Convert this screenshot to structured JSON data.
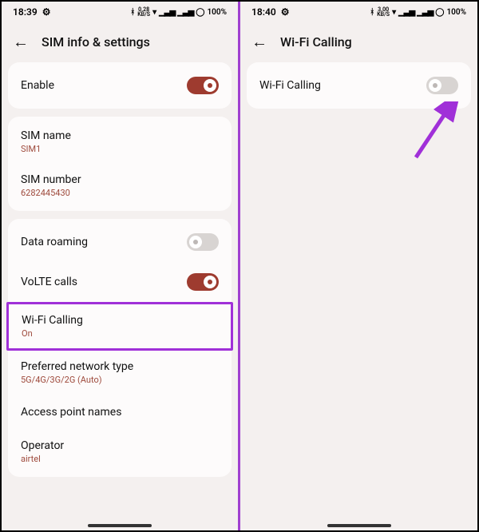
{
  "left": {
    "status": {
      "time": "18:39",
      "speed": "0.28",
      "speedUnit": "KB/S",
      "battery": "100%"
    },
    "header": {
      "title": "SIM info & settings"
    },
    "enable": {
      "label": "Enable"
    },
    "sim": {
      "nameLabel": "SIM name",
      "nameValue": "SIM1",
      "numberLabel": "SIM number",
      "numberValue": "6282445430"
    },
    "rows": {
      "dataRoaming": "Data roaming",
      "volte": "VoLTE calls",
      "wifiCalling": "Wi-Fi Calling",
      "wifiCallingStatus": "On",
      "prefNet": "Preferred network type",
      "prefNetValue": "5G/4G/3G/2G (Auto)",
      "apn": "Access point names",
      "operator": "Operator",
      "operatorValue": "airtel"
    }
  },
  "right": {
    "status": {
      "time": "18:40",
      "speed": "3.00",
      "speedUnit": "KB/S",
      "battery": "100%"
    },
    "header": {
      "title": "Wi-Fi Calling"
    },
    "row": {
      "label": "Wi-Fi Calling"
    }
  }
}
